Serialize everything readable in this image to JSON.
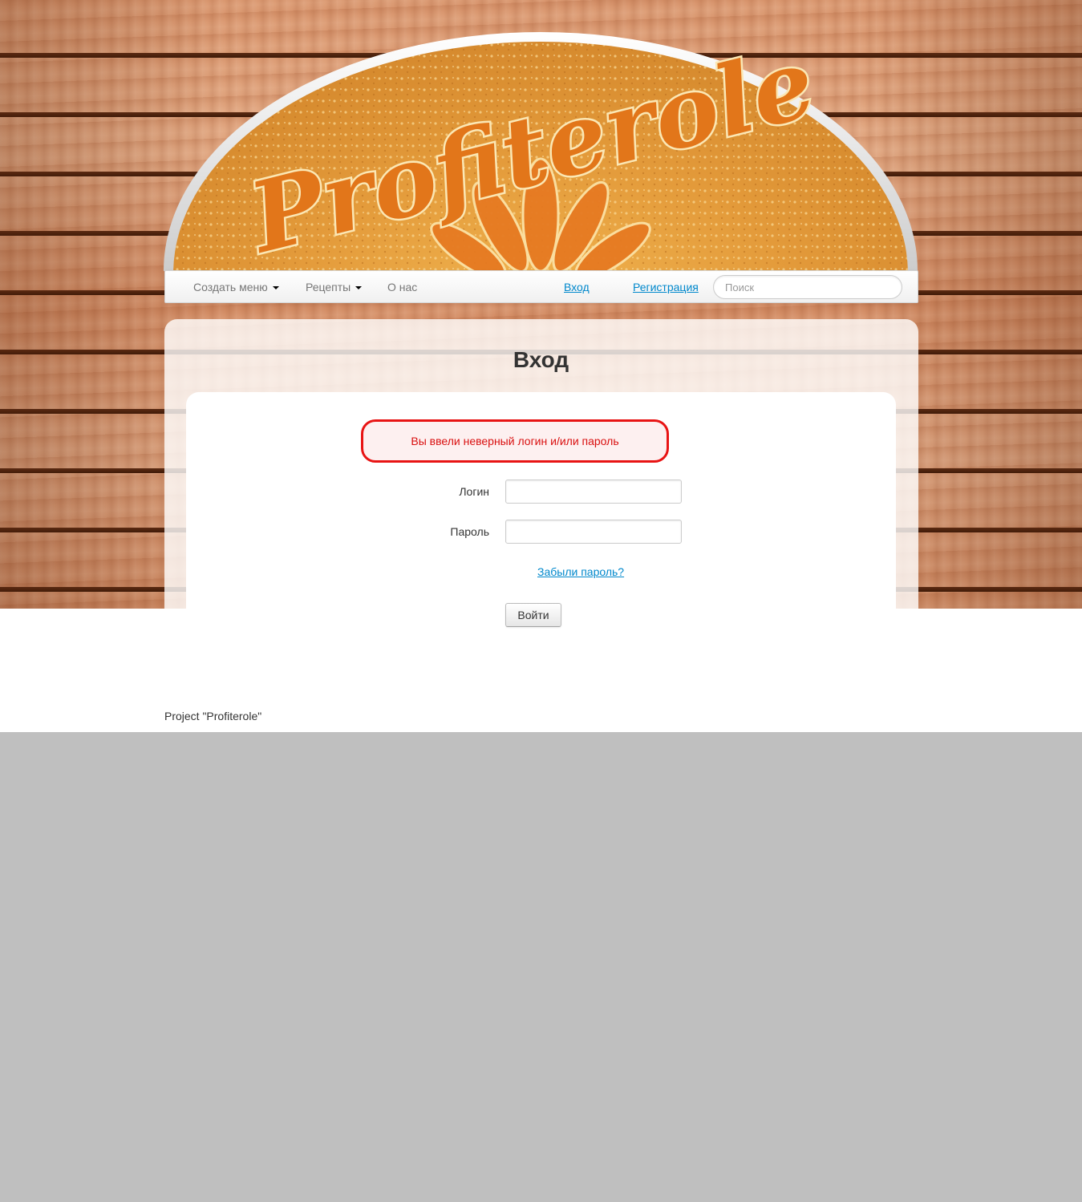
{
  "logo": {
    "text": "Profiterole",
    "icon": "profiterole-logo"
  },
  "navbar": {
    "menu_items": [
      {
        "label": "Создать меню",
        "dropdown": true
      },
      {
        "label": "Рецепты",
        "dropdown": true
      },
      {
        "label": "О нас",
        "dropdown": false
      }
    ],
    "login_link": "Вход",
    "register_link": "Регистрация",
    "search_placeholder": "Поиск"
  },
  "page": {
    "title": "Вход",
    "error_message": "Вы ввели неверный логин и/или пароль",
    "login_label": "Логин",
    "login_value": "",
    "password_label": "Пароль",
    "password_value": "",
    "forgot_link": "Забыли пароль?",
    "submit_label": "Войти"
  },
  "footer": {
    "text": "Project \"Profiterole\""
  },
  "colors": {
    "link": "#0088cc",
    "error": "#e81414",
    "wood": "#d9966e",
    "logo_cake": "#e8a33c"
  }
}
